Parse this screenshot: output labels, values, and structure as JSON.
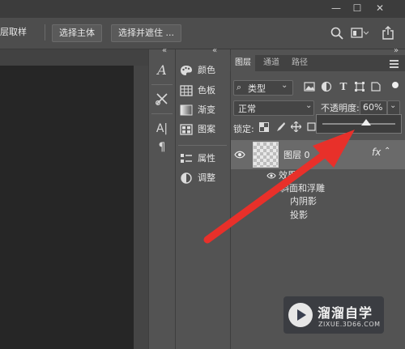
{
  "titlebar": {
    "minimize": "—",
    "restore": "☐",
    "close": "✕"
  },
  "options_bar": {
    "sample_layers_label": "层取样",
    "select_subject": "选择主体",
    "select_and_mask": "选择并遮住 ...",
    "icons": [
      "search-icon",
      "workspace-icon",
      "share-icon"
    ]
  },
  "strip": {
    "collapse": "«",
    "icons": [
      "character-icon",
      "tool-icon",
      "paragraph-icon",
      "pilcrow-icon"
    ]
  },
  "panels": {
    "collapse": "«",
    "items": [
      {
        "label": "颜色",
        "icon": "palette-icon"
      },
      {
        "label": "色板",
        "icon": "swatches-icon"
      },
      {
        "label": "渐变",
        "icon": "gradient-icon"
      },
      {
        "label": "图案",
        "icon": "pattern-icon"
      },
      {
        "label": "属性",
        "icon": "properties-icon"
      },
      {
        "label": "调整",
        "icon": "adjustments-icon"
      }
    ]
  },
  "layers_panel": {
    "tabs": [
      "图层",
      "通道",
      "路径"
    ],
    "filter_type": "类型",
    "blend_mode": "正常",
    "opacity_label": "不透明度:",
    "opacity_value": "60%",
    "opacity_fraction": 0.6,
    "lock_label": "锁定:",
    "layer_name": "图层 0",
    "fx_label": "fx",
    "effects_label": "效果",
    "effects": [
      "斜面和浮雕",
      "内阴影",
      "投影"
    ]
  },
  "watermark": {
    "name": "溜溜自学",
    "url": "ZIXUE.3D66.COM"
  },
  "colors": {
    "arrow": "#e8302a",
    "panel_bg": "#535353",
    "canvas_bg": "#262626"
  }
}
